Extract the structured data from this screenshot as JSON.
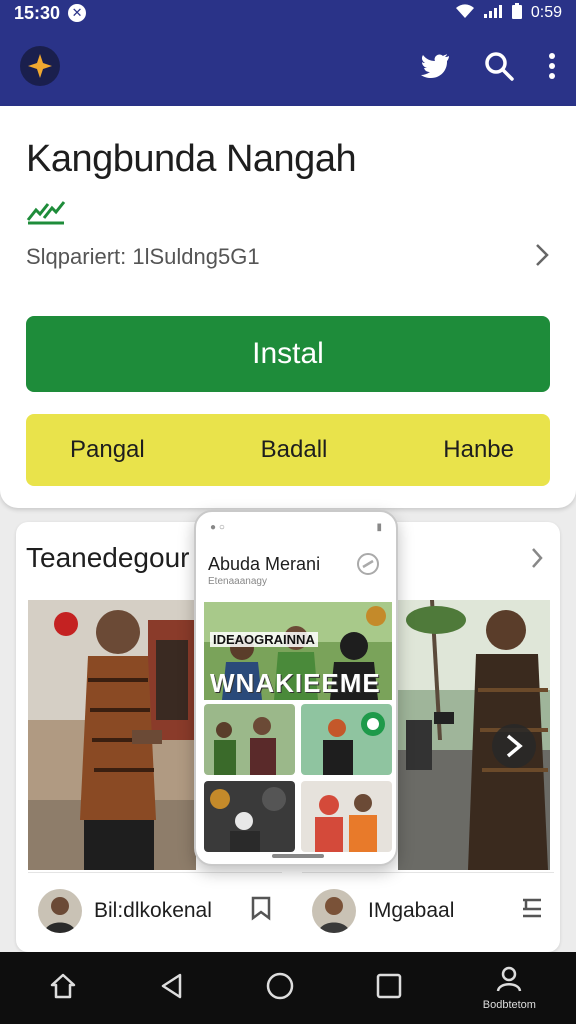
{
  "status_bar": {
    "time": "15:30",
    "right_text": "0:59"
  },
  "app_bar": {
    "icons": [
      "app-logo-icon",
      "twitter-icon",
      "search-icon",
      "more-icon"
    ]
  },
  "app": {
    "title": "Kangbunda Nangah",
    "subtitle": "Slqpariert: 1lSuldng5G1",
    "install_label": "Instal",
    "chips": [
      "Pangal",
      "Badall",
      "Hanbe"
    ]
  },
  "section": {
    "title": "Teanedegour",
    "cards": [
      {
        "user_name": "Bil:dlkokenal"
      },
      {
        "user_name": "IMgabaal"
      }
    ]
  },
  "overlay": {
    "title": "Abuda Merani",
    "subtitle": "Etenaaanagy",
    "banner_text_1": "IDEAOGRAINNA",
    "banner_text_2": "WNAKIEEME"
  },
  "nav": {
    "home": "",
    "back": "",
    "circle": "",
    "recent": "",
    "profile_label": "Bodbtetom"
  },
  "colors": {
    "primary": "#2a3388",
    "install": "#1e8c3a",
    "chips": "#e9e34b",
    "nav": "#0e0e0e"
  }
}
